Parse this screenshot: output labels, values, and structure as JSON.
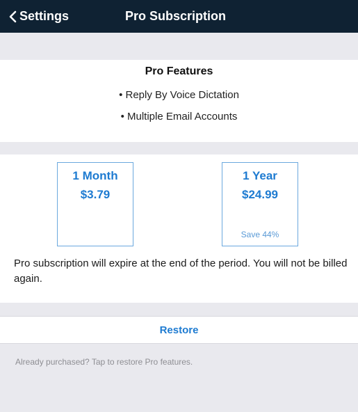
{
  "nav": {
    "back_label": "Settings",
    "title": "Pro Subscription"
  },
  "features": {
    "title": "Pro Features",
    "items": [
      "• Reply By Voice Dictation",
      "• Multiple Email Accounts"
    ]
  },
  "plans": [
    {
      "term": "1 Month",
      "price": "$3.79",
      "save": ""
    },
    {
      "term": "1 Year",
      "price": "$24.99",
      "save": "Save 44%"
    }
  ],
  "plan_note": "Pro subscription will expire at the end of the period. You will not be billed again.",
  "restore": {
    "label": "Restore",
    "footer": "Already purchased? Tap to restore Pro features."
  },
  "colors": {
    "nav_bg": "#0f2233",
    "accent": "#1e7bd1",
    "group_bg": "#e9e9ee"
  },
  "icons": {
    "back": "chevron-left-icon"
  }
}
